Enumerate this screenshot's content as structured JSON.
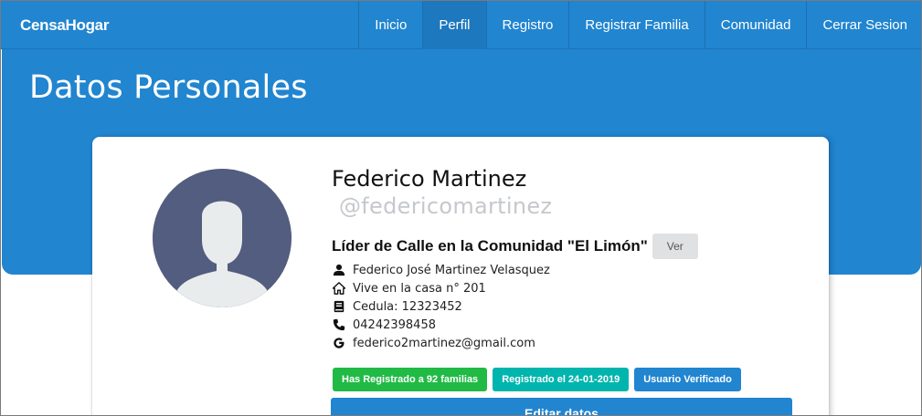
{
  "navbar": {
    "brand": "CensaHogar",
    "items": [
      {
        "label": "Inicio",
        "active": false
      },
      {
        "label": "Perfil",
        "active": true
      },
      {
        "label": "Registro",
        "active": false
      },
      {
        "label": "Registrar Familia",
        "active": false
      },
      {
        "label": "Comunidad",
        "active": false
      },
      {
        "label": "Cerrar Sesion",
        "active": false
      }
    ]
  },
  "hero": {
    "title": "Datos Personales"
  },
  "profile": {
    "name": "Federico Martinez",
    "username": "@federicomartinez",
    "role": "Líder de Calle en la Comunidad \"El Limón\"",
    "ver_label": "Ver",
    "details": [
      {
        "icon": "user-icon",
        "text": "Federico José Martinez Velasquez"
      },
      {
        "icon": "home-icon",
        "text": "Vive en la casa n° 201"
      },
      {
        "icon": "id-card-icon",
        "text": "Cedula: 12323452"
      },
      {
        "icon": "phone-icon",
        "text": "04242398458"
      },
      {
        "icon": "google-icon",
        "text": "federico2martinez@gmail.com"
      }
    ],
    "badges": [
      {
        "text": "Has Registrado a 92 familias",
        "color": "#21ba45"
      },
      {
        "text": "Registrado el 24-01-2019",
        "color": "#00b5ad"
      },
      {
        "text": "Usuario Verificado",
        "color": "#2185d0"
      }
    ],
    "edit_label": "Editar datos"
  },
  "colors": {
    "primary": "#2185d0",
    "avatar_bg": "#525d7f",
    "avatar_figure": "#e8eced"
  }
}
